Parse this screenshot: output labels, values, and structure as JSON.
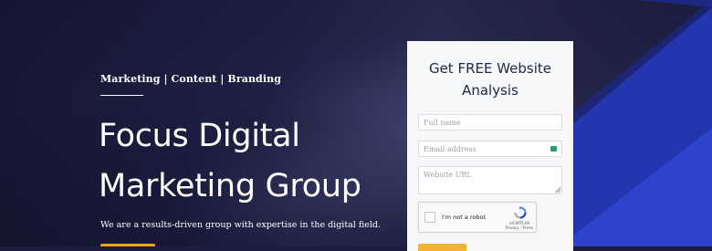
{
  "hero": {
    "tagline": "Marketing | Content | Branding",
    "headline": "Focus Digital Marketing Group",
    "description": "We are a results-driven group with expertise in the digital field."
  },
  "form": {
    "title": "Get FREE Website Analysis",
    "fields": {
      "full_name_placeholder": "Full name",
      "email_placeholder": "Email address",
      "website_placeholder": "Website URL"
    },
    "recaptcha": {
      "label": "I'm not a robot",
      "brand": "reCAPTCHA",
      "links": "Privacy - Terms"
    }
  },
  "colors": {
    "accent_blue": "#2a3fc4",
    "cta_orange": "#f2b233",
    "email_badge": "#1aa37a"
  }
}
